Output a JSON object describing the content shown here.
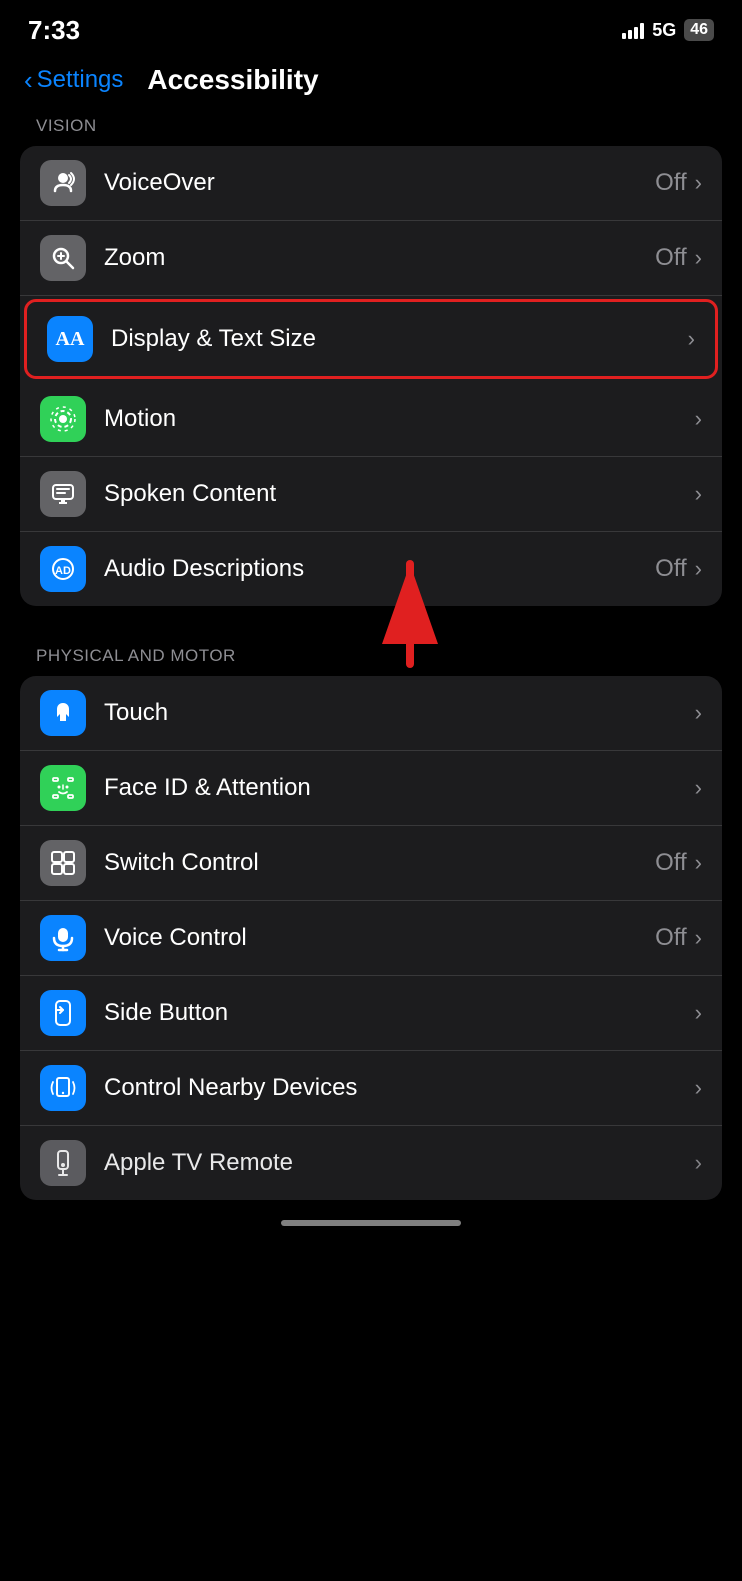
{
  "statusBar": {
    "time": "7:33",
    "network": "5G",
    "battery": "46"
  },
  "navigation": {
    "backLabel": "Settings",
    "pageTitle": "Accessibility"
  },
  "sections": {
    "vision": {
      "header": "VISION",
      "items": [
        {
          "id": "voiceover",
          "icon": "voiceover",
          "iconBg": "gray",
          "label": "VoiceOver",
          "value": "Off",
          "hasChevron": true
        },
        {
          "id": "zoom",
          "icon": "zoom",
          "iconBg": "gray",
          "label": "Zoom",
          "value": "Off",
          "hasChevron": true
        },
        {
          "id": "display-text-size",
          "icon": "AA",
          "iconBg": "blue",
          "label": "Display & Text Size",
          "value": "",
          "hasChevron": true,
          "highlighted": true
        },
        {
          "id": "motion",
          "icon": "motion",
          "iconBg": "green",
          "label": "Motion",
          "value": "",
          "hasChevron": true
        },
        {
          "id": "spoken-content",
          "icon": "spoken",
          "iconBg": "gray",
          "label": "Spoken Content",
          "value": "",
          "hasChevron": true
        },
        {
          "id": "audio-descriptions",
          "icon": "audio",
          "iconBg": "blue",
          "label": "Audio Descriptions",
          "value": "Off",
          "hasChevron": true
        }
      ]
    },
    "physicalMotor": {
      "header": "PHYSICAL AND MOTOR",
      "items": [
        {
          "id": "touch",
          "icon": "touch",
          "iconBg": "blue",
          "label": "Touch",
          "value": "",
          "hasChevron": true
        },
        {
          "id": "face-id",
          "icon": "faceid",
          "iconBg": "green",
          "label": "Face ID & Attention",
          "value": "",
          "hasChevron": true
        },
        {
          "id": "switch-control",
          "icon": "switch",
          "iconBg": "gray",
          "label": "Switch Control",
          "value": "Off",
          "hasChevron": true
        },
        {
          "id": "voice-control",
          "icon": "voice",
          "iconBg": "blue",
          "label": "Voice Control",
          "value": "Off",
          "hasChevron": true
        },
        {
          "id": "side-button",
          "icon": "side",
          "iconBg": "blue",
          "label": "Side Button",
          "value": "",
          "hasChevron": true
        },
        {
          "id": "nearby-devices",
          "icon": "nearby",
          "iconBg": "blue",
          "label": "Control Nearby Devices",
          "value": "",
          "hasChevron": true
        },
        {
          "id": "apple-tv",
          "icon": "appletv",
          "iconBg": "gray",
          "label": "Apple TV Remote",
          "value": "",
          "hasChevron": true,
          "partial": true
        }
      ]
    }
  }
}
